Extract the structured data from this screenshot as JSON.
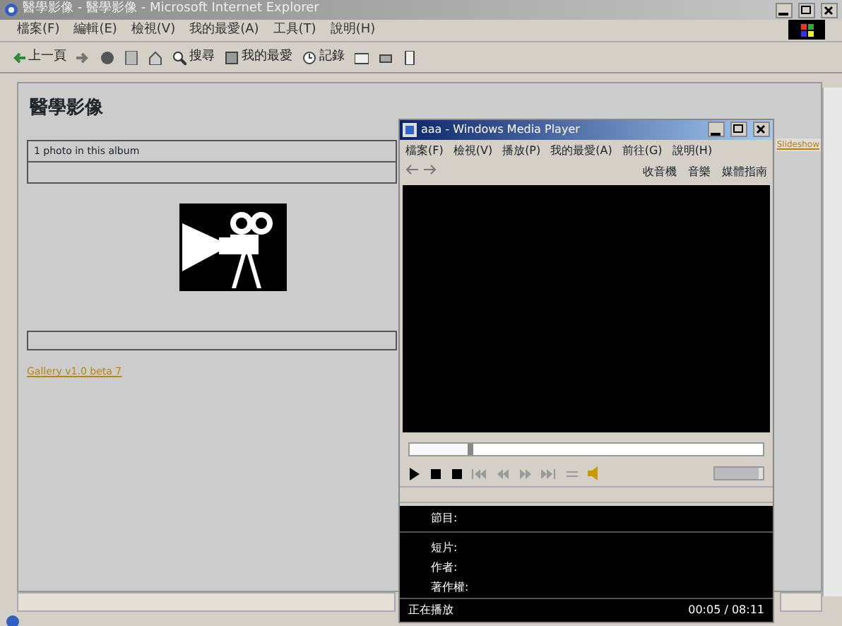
{
  "browser": {
    "title": "醫學影像 - 醫學影像 - Microsoft Internet Explorer",
    "menu": [
      "檔案(F)",
      "編輯(E)",
      "檢視(V)",
      "我的最愛(A)",
      "工具(T)",
      "說明(H)"
    ],
    "toolbar": [
      {
        "kind": "back",
        "label": "上一頁"
      },
      {
        "kind": "forward"
      },
      {
        "kind": "stop"
      },
      {
        "kind": "refresh"
      },
      {
        "kind": "home"
      },
      {
        "kind": "search",
        "label": "搜尋"
      },
      {
        "kind": "favorites",
        "label": "我的最愛"
      },
      {
        "kind": "history",
        "label": "記錄"
      },
      {
        "kind": "mail"
      },
      {
        "kind": "print"
      },
      {
        "kind": "edit"
      }
    ]
  },
  "page": {
    "heading": "醫學影像",
    "album_count": "1 photo in this album",
    "slideshow": "Slideshow",
    "footer_link": "Gallery v1.0 beta 7"
  },
  "player": {
    "title": "aaa - Windows Media Player",
    "menu": [
      "檔案(F)",
      "檢視(V)",
      "播放(P)",
      "我的最愛(A)",
      "前往(G)",
      "說明(H)"
    ],
    "links": [
      "收音機",
      "音樂",
      "媒體指南"
    ],
    "seek": {
      "level": 0.18
    },
    "volume": {
      "level": 0.9
    },
    "info": [
      {
        "label": "節目:"
      },
      {
        "label": "短片:"
      },
      {
        "label": "作者:"
      },
      {
        "label": "著作權:"
      }
    ],
    "status": "正在播放",
    "time": "00:05 / 08:11"
  }
}
